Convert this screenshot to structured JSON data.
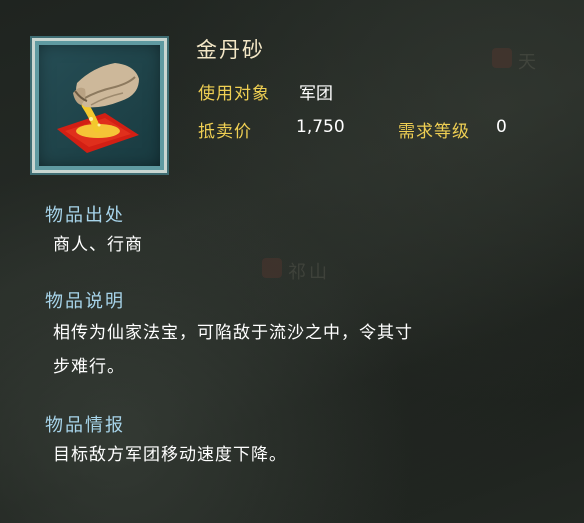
{
  "item": {
    "name": "金丹砂",
    "icon": "golden-sand-pouch-icon",
    "target_label": "使用对象",
    "target_value": "军团",
    "price_label": "抵卖价",
    "price_value": "1,750",
    "level_label": "需求等级",
    "level_value": "0"
  },
  "sections": {
    "source": {
      "title": "物品出处",
      "body": "商人、行商"
    },
    "description": {
      "title": "物品说明",
      "line1": "相传为仙家法宝，可陷敌于流沙之中，令其寸",
      "line2": "步难行。"
    },
    "intel": {
      "title": "物品情报",
      "body": "目标敌方军团移动速度下降。"
    }
  },
  "colors": {
    "label": "#efcf53",
    "section_title": "#a7d4ea",
    "value": "#ffffff",
    "item_name": "#f3e7c6",
    "frame_border": "#c9d6d1",
    "frame_fill": "#264e56"
  }
}
